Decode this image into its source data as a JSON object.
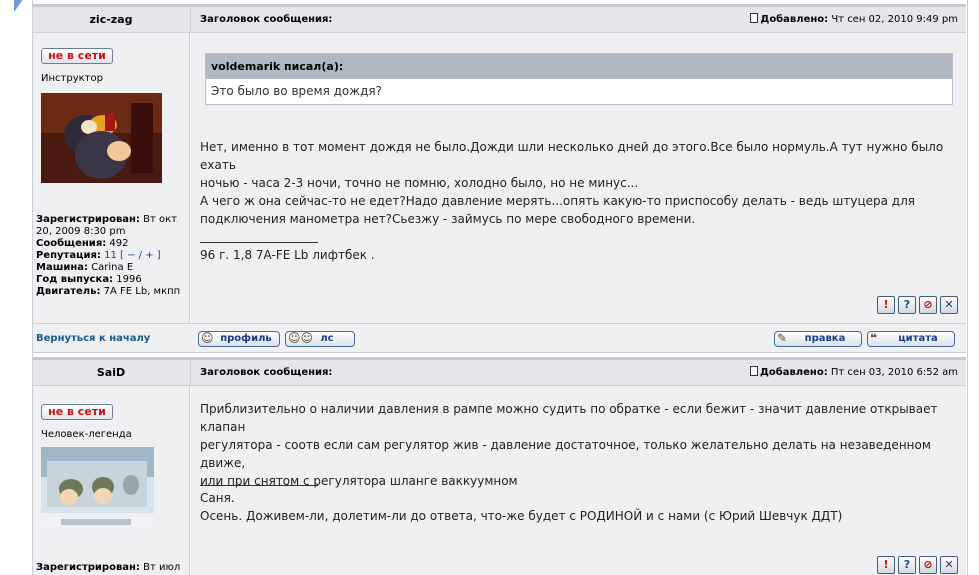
{
  "post1": {
    "author": "zic-zag",
    "subject_label": "Заголовок сообщения:",
    "posted_label": "Добавлено:",
    "date": "Чт сен 02, 2010 9:49 pm",
    "status": "не в сети",
    "rank": "Инструктор",
    "registered_label": "Зарегистрирован:",
    "registered": "Вт окт 20, 2009 8:30 pm",
    "messages_label": "Сообщения:",
    "messages": "492",
    "reputation_label": "Репутация:",
    "reputation": "11",
    "rep_controls": "[ − / + ]",
    "car_label": "Машина:",
    "car": "Carina E",
    "year_label": "Год выпуска:",
    "year": "1996",
    "engine_label": "Двигатель:",
    "engine": "7A FE Lb, мкпп",
    "quote_author": "voldemarik писал(а):",
    "quote_text": "Это было во время дождя?",
    "body_lines": [
      "Нет, именно в тот момент дождя не было.Дожди шли несколько дней до этого.Все было нормуль.А тут нужно было ехать",
      "ночью - часа 2-3 ночи, точно не помню, холодно было, но не минус...",
      "А чего ж она сейчас-то не едет?Надо давление мерять...опять какую-то приспособу делать - ведь штуцера для",
      "подключения манометра нет?Сьезжу - займусь по мере свободного времени."
    ],
    "signature": "96 г. 1,8 7A-FE Lb лифтбек ."
  },
  "footer": {
    "back_to_top": "Вернуться к началу",
    "profile_btn": "профиль",
    "pm_btn": "лс",
    "edit_btn": "правка",
    "quote_btn": "цитата"
  },
  "post2": {
    "author": "SaiD",
    "subject_label": "Заголовок сообщения:",
    "posted_label": "Добавлено:",
    "date": "Пт сен 03, 2010 6:52 am",
    "status": "не в сети",
    "rank": "Человек-легенда",
    "registered_label": "Зарегистрирован:",
    "registered": "Вт июл",
    "body_lines": [
      "Приблизительно о наличии давления в рампе можно судить по обратке - если бежит - значит давление открывает клапан",
      "регулятора - соотв если сам регулятор жив - давление достаточное, только желательно делать на незаведенном движе,",
      "или при снятом с регулятора шланге ваккуумном"
    ],
    "signature_lines": [
      "Саня.",
      "Осень. Доживем-ли, долетим-ли до ответа, что-же будет с РОДИНОЙ и с нами (с Юрий Шевчук ДДТ)"
    ]
  },
  "icons": [
    "warn-icon",
    "help-icon",
    "block-icon",
    "close-icon"
  ],
  "colors": {
    "header_bg": "#e3e7ea",
    "body_bg": "#eef0f2",
    "offline_red": "#d01010",
    "link_blue": "#1a5a8a"
  }
}
